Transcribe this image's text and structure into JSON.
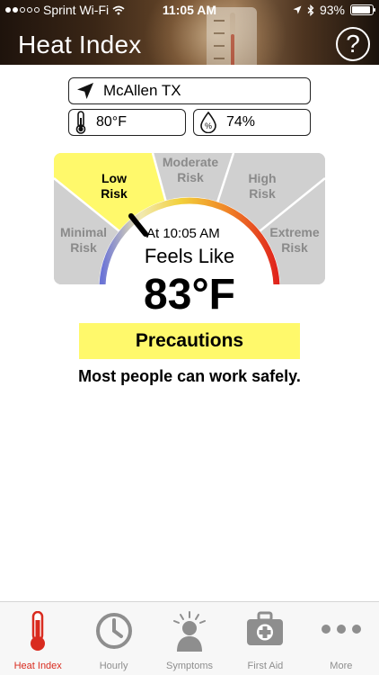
{
  "status_bar": {
    "carrier": "Sprint Wi-Fi",
    "time": "11:05 AM",
    "battery": "93%",
    "battery_level": 0.93
  },
  "header": {
    "title": "Heat Index",
    "help_label": "?"
  },
  "location": {
    "name": "McAllen TX",
    "icon": "location-arrow-icon"
  },
  "readings": {
    "temperature": "80°F",
    "temperature_icon": "thermometer-icon",
    "humidity": "74%",
    "humidity_icon": "humidity-drop-icon",
    "humidity_icon_glyph": "%"
  },
  "gauge": {
    "risks": [
      {
        "label_line1": "Minimal",
        "label_line2": "Risk",
        "active": false
      },
      {
        "label_line1": "Low",
        "label_line2": "Risk",
        "active": true
      },
      {
        "label_line1": "Moderate",
        "label_line2": "Risk",
        "active": false
      },
      {
        "label_line1": "High",
        "label_line2": "Risk",
        "active": false
      },
      {
        "label_line1": "Extreme",
        "label_line2": "Risk",
        "active": false
      }
    ],
    "time_text": "At 10:05 AM",
    "feels_like_label": "Feels Like",
    "feels_like_value": "83°F",
    "colors": {
      "active_segment": "#fff96b",
      "inactive_segment": "#d0d0d0"
    }
  },
  "precautions": {
    "label": "Precautions",
    "message": "Most people can work safely.",
    "color": "#fff96b"
  },
  "tabs": [
    {
      "label": "Heat Index",
      "icon": "thermometer-icon",
      "active": true
    },
    {
      "label": "Hourly",
      "icon": "clock-icon",
      "active": false
    },
    {
      "label": "Symptoms",
      "icon": "person-heat-icon",
      "active": false
    },
    {
      "label": "First Aid",
      "icon": "first-aid-kit-icon",
      "active": false
    },
    {
      "label": "More",
      "icon": "more-dots-icon",
      "active": false
    }
  ],
  "colors": {
    "accent_red": "#d92b1f",
    "tab_gray": "#8e8e8e"
  }
}
